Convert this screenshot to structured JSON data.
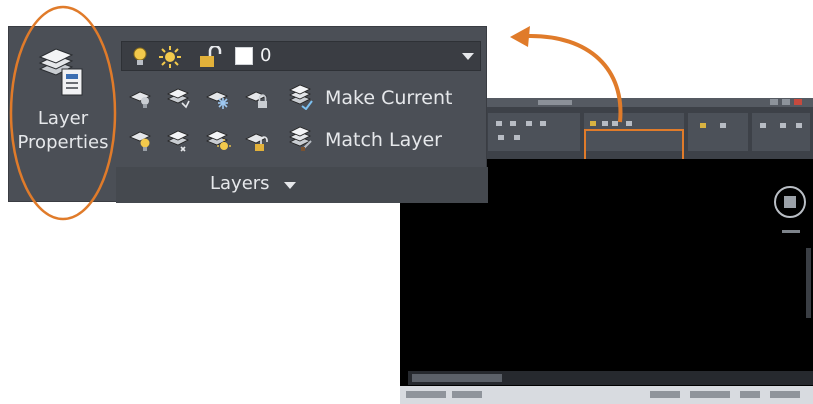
{
  "layers_panel": {
    "layer_properties_label": "Layer\nProperties",
    "current_layer": {
      "name": "0",
      "swatch_color": "#ffffff",
      "state_icons": [
        "lightbulb-on-icon",
        "sun-thaw-icon",
        "padlock-unlocked-icon"
      ]
    },
    "tool_row_1": [
      "layer-off-icon",
      "layer-isolate-icon",
      "layer-freeze-icon",
      "layer-lock-icon"
    ],
    "tool_row_2": [
      "layer-on-icon",
      "layer-unisolate-icon",
      "layer-thaw-icon",
      "layer-unlock-icon"
    ],
    "make_current_label": "Make Current",
    "match_layer_label": "Match Layer",
    "panel_title": "Layers"
  },
  "annotations": {
    "highlight_color": "#e07b2a"
  },
  "thumbnail": {
    "description_icon": "autocad-window-thumbnail"
  }
}
